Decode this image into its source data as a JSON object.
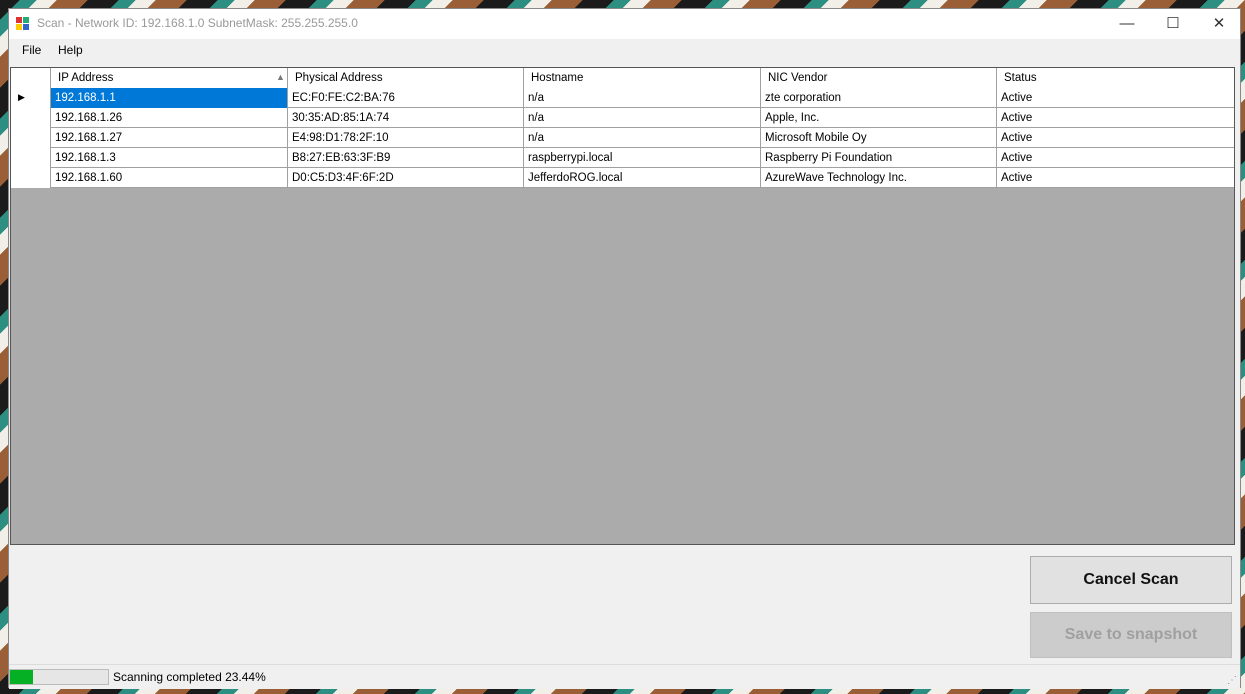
{
  "window": {
    "title": "Scan - Network ID: 192.168.1.0 SubnetMask: 255.255.255.0",
    "minimize_glyph": "—",
    "maximize_glyph": "☐",
    "close_glyph": "✕"
  },
  "menu": {
    "file": "File",
    "help": "Help"
  },
  "grid": {
    "columns": [
      "IP Address",
      "Physical Address",
      "Hostname",
      "NIC Vendor",
      "Status"
    ],
    "sort_icon": "sort-ascending-icon",
    "rows": [
      [
        "192.168.1.1",
        "EC:F0:FE:C2:BA:76",
        "n/a",
        "zte corporation",
        "Active"
      ],
      [
        "192.168.1.26",
        "30:35:AD:85:1A:74",
        "n/a",
        "Apple, Inc.",
        "Active"
      ],
      [
        "192.168.1.27",
        "E4:98:D1:78:2F:10",
        "n/a",
        "Microsoft Mobile Oy",
        "Active"
      ],
      [
        "192.168.1.3",
        "B8:27:EB:63:3F:B9",
        "raspberrypi.local",
        "Raspberry Pi Foundation",
        "Active"
      ],
      [
        "192.168.1.60",
        "D0:C5:D3:4F:6F:2D",
        "JefferdoROG.local",
        "AzureWave Technology Inc.",
        "Active"
      ]
    ],
    "selected_row": 0
  },
  "buttons": {
    "cancel": "Cancel Scan",
    "save": "Save to snapshot"
  },
  "status": {
    "text": "Scanning completed 23.44%",
    "progress": 0.2344,
    "progress_color": "#06b025"
  },
  "colors": {
    "selection": "#0078d7",
    "grid_background": "#ababab"
  }
}
